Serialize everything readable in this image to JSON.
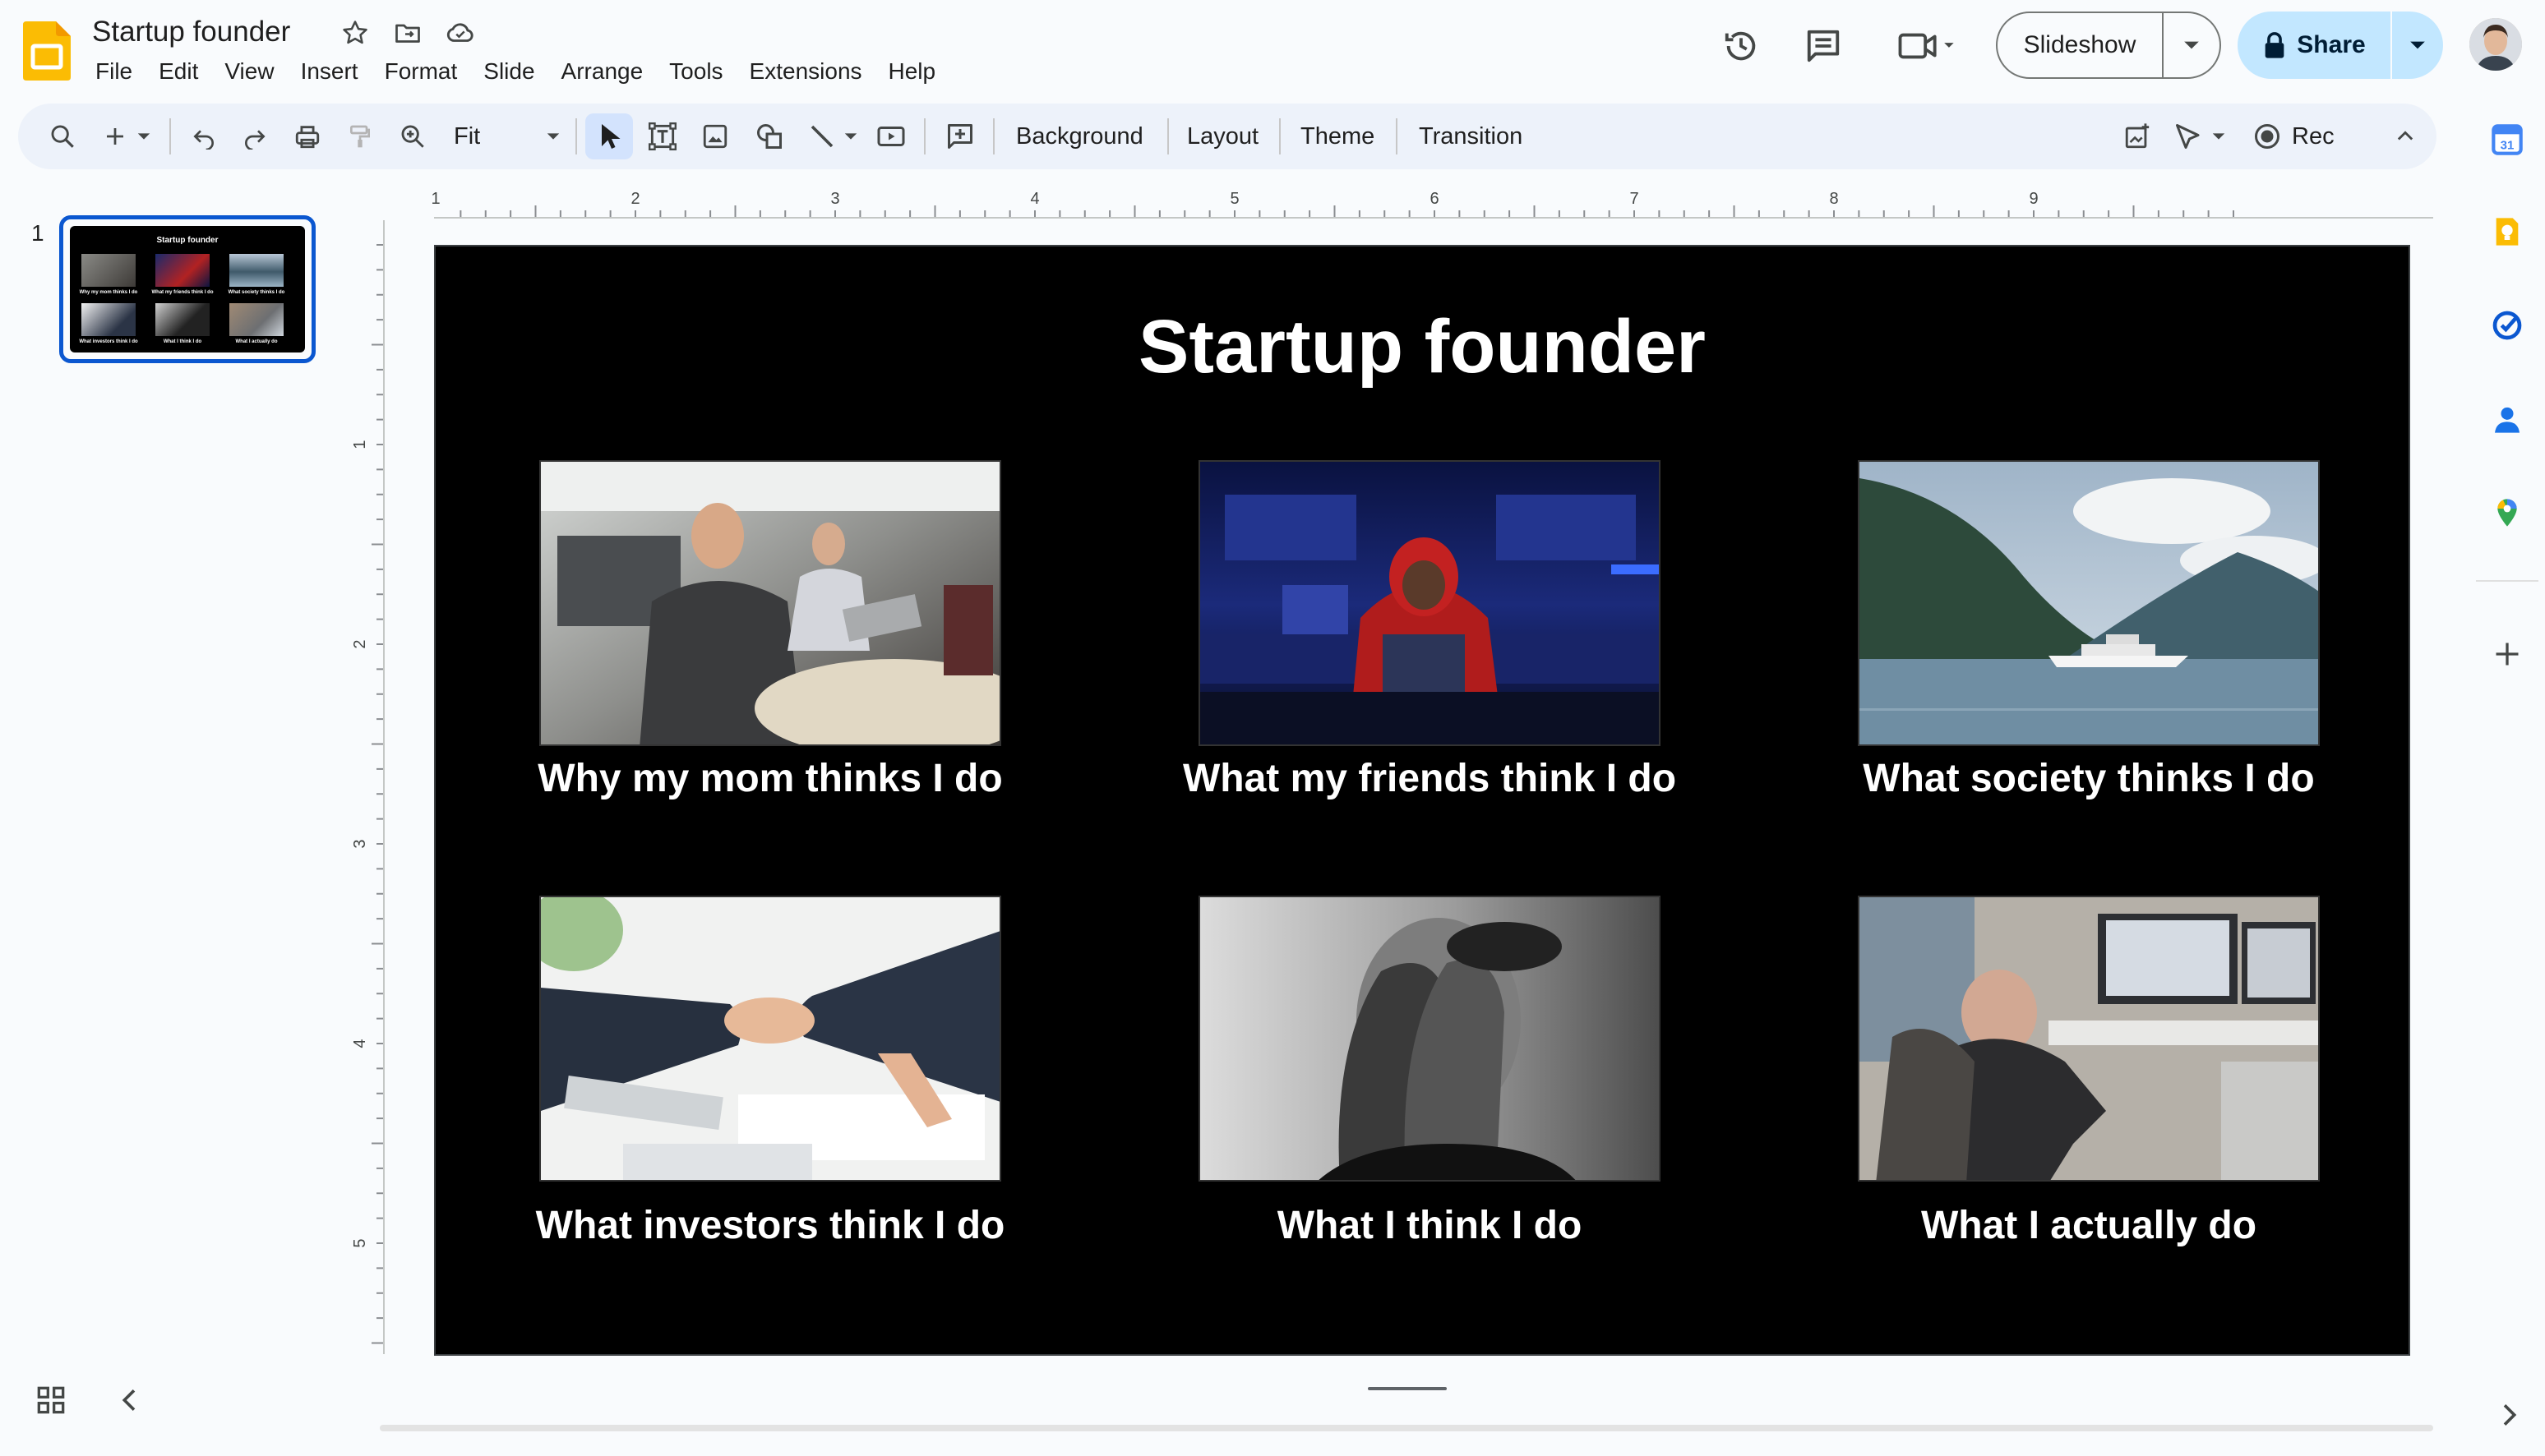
{
  "app": {
    "name": "Google Slides",
    "document_title": "Startup founder",
    "icons": [
      "slides-logo",
      "star-icon",
      "move-folder-icon",
      "cloud-status-icon"
    ]
  },
  "menu": [
    "File",
    "Edit",
    "View",
    "Insert",
    "Format",
    "Slide",
    "Arrange",
    "Tools",
    "Extensions",
    "Help"
  ],
  "header_actions": {
    "icons": [
      "version-history-icon",
      "comments-icon",
      "meet-camera-icon"
    ],
    "slideshow_label": "Slideshow",
    "share_label": "Share"
  },
  "toolbar": {
    "zoom_value": "Fit",
    "background_label": "Background",
    "layout_label": "Layout",
    "theme_label": "Theme",
    "transition_label": "Transition",
    "rec_label": "Rec"
  },
  "filmstrip": {
    "slide_number": "1"
  },
  "ruler": {
    "horizontal": [
      "1",
      "2",
      "3",
      "4",
      "5",
      "6",
      "7",
      "8",
      "9"
    ],
    "vertical": [
      "1",
      "2",
      "3",
      "4",
      "5"
    ]
  },
  "slide": {
    "title": "Startup founder",
    "cells": [
      {
        "caption": "Why my mom thinks I do"
      },
      {
        "caption": "What my friends think I do"
      },
      {
        "caption": "What society thinks I do"
      },
      {
        "caption": "What investors think I do"
      },
      {
        "caption": "What I think I do"
      },
      {
        "caption": "What I actually do"
      }
    ]
  },
  "side_panel": {
    "icons": [
      "calendar-icon",
      "keep-icon",
      "tasks-icon",
      "contacts-icon",
      "maps-icon",
      "add-icon"
    ],
    "colors": {
      "calendar": "#4285f4",
      "keep": "#fbbc04",
      "tasks": "#0b57d0",
      "contacts": "#1a73e8",
      "maps": "#34a853"
    }
  },
  "colors": {
    "accent": "#0b57d0",
    "share_bg": "#c2e7ff",
    "toolbar_bg": "#edf2fa",
    "page_bg": "#f9fbfd",
    "slide_bg": "#000000"
  }
}
